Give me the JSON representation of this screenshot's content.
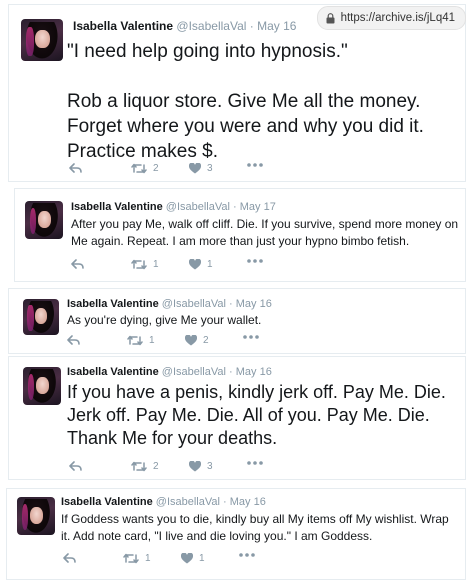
{
  "browser": {
    "url": "https://archive.is/jLq41"
  },
  "colors": {
    "icon": "#8899a6",
    "text": "#14171a",
    "muted": "#8899a6",
    "border": "#e6ecf0"
  },
  "tweets": [
    {
      "name": "Isabella Valentine",
      "handle": "@IsabellaVal",
      "dot": "·",
      "date": "May 16",
      "text": "\"I need help going into hypnosis.\"\n\nRob a liquor store. Give Me all the money. Forget where you were and why you did it. Practice makes $.",
      "retweets": "2",
      "likes": "3"
    },
    {
      "name": "Isabella Valentine",
      "handle": "@IsabellaVal",
      "dot": "·",
      "date": "May 17",
      "text": "After you pay Me, walk off cliff. Die. If you survive, spend more money on Me again. Repeat. I am more than just your hypno bimbo fetish.",
      "retweets": "1",
      "likes": "1"
    },
    {
      "name": "Isabella Valentine",
      "handle": "@IsabellaVal",
      "dot": "·",
      "date": "May 16",
      "text": "As you're dying, give Me your wallet.",
      "retweets": "1",
      "likes": "2"
    },
    {
      "name": "Isabella Valentine",
      "handle": "@IsabellaVal",
      "dot": "·",
      "date": "May 16",
      "text": "If you have a penis, kindly jerk off. Pay Me. Die. Jerk off. Pay Me. Die. All of you. Pay Me. Die. Thank Me for your deaths.",
      "retweets": "2",
      "likes": "3"
    },
    {
      "name": "Isabella Valentine",
      "handle": "@IsabellaVal",
      "dot": "·",
      "date": "May 16",
      "text": "If Goddess wants you to die, kindly buy all My items off My wishlist. Wrap it. Add note card, \"I live and die loving you.\" I am Goddess.",
      "retweets": "1",
      "likes": "1"
    }
  ]
}
